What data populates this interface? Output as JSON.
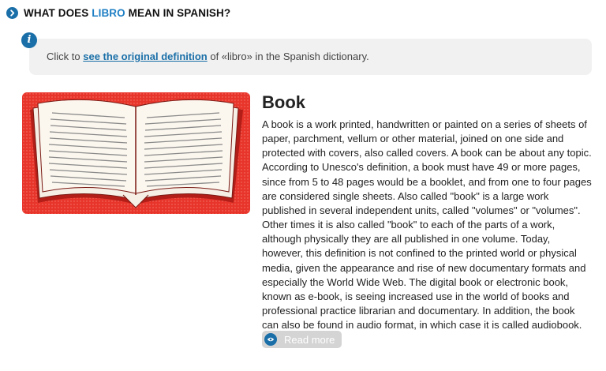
{
  "section": {
    "heading_prefix": "WHAT DOES",
    "heading_keyword": "LIBRO",
    "heading_suffix": "MEAN IN SPANISH?"
  },
  "info": {
    "icon": "info-icon",
    "text_prefix": "Click to",
    "link_text": "see the original definition",
    "text_suffix": "of «libro» in the Spanish dictionary."
  },
  "entry": {
    "image_alt": "open-book-illustration",
    "title": "Book",
    "description": "A book is a work printed, handwritten or painted on a series of sheets of paper, parchment, vellum or other material, joined on one side and protected with covers, also called covers. A book can be about any topic. According to Unesco's definition, a book must have 49 or more pages, since from 5 to 48 pages would be a booklet, and from one to four pages are considered single sheets. Also called \"book\" is a large work published in several independent units, called \"volumes\" or \"volumes\". Other times it is also called \"book\" to each of the parts of a work, although physically they are all published in one volume. Today, however, this definition is not confined to the printed world or physical media, given the appearance and rise of new documentary formats and especially the World Wide Web. The digital book or electronic book, known as e-book, is seeing increased use in the world of books and professional practice librarian and documentary. In addition, the book can also be found in audio format, in which case it is called audiobook.",
    "read_more_label": "Read more"
  },
  "colors": {
    "accent": "#1a6fa8",
    "keyword": "#1f7fc4",
    "book_background": "#e8352b",
    "info_background": "#f1f1f1"
  }
}
